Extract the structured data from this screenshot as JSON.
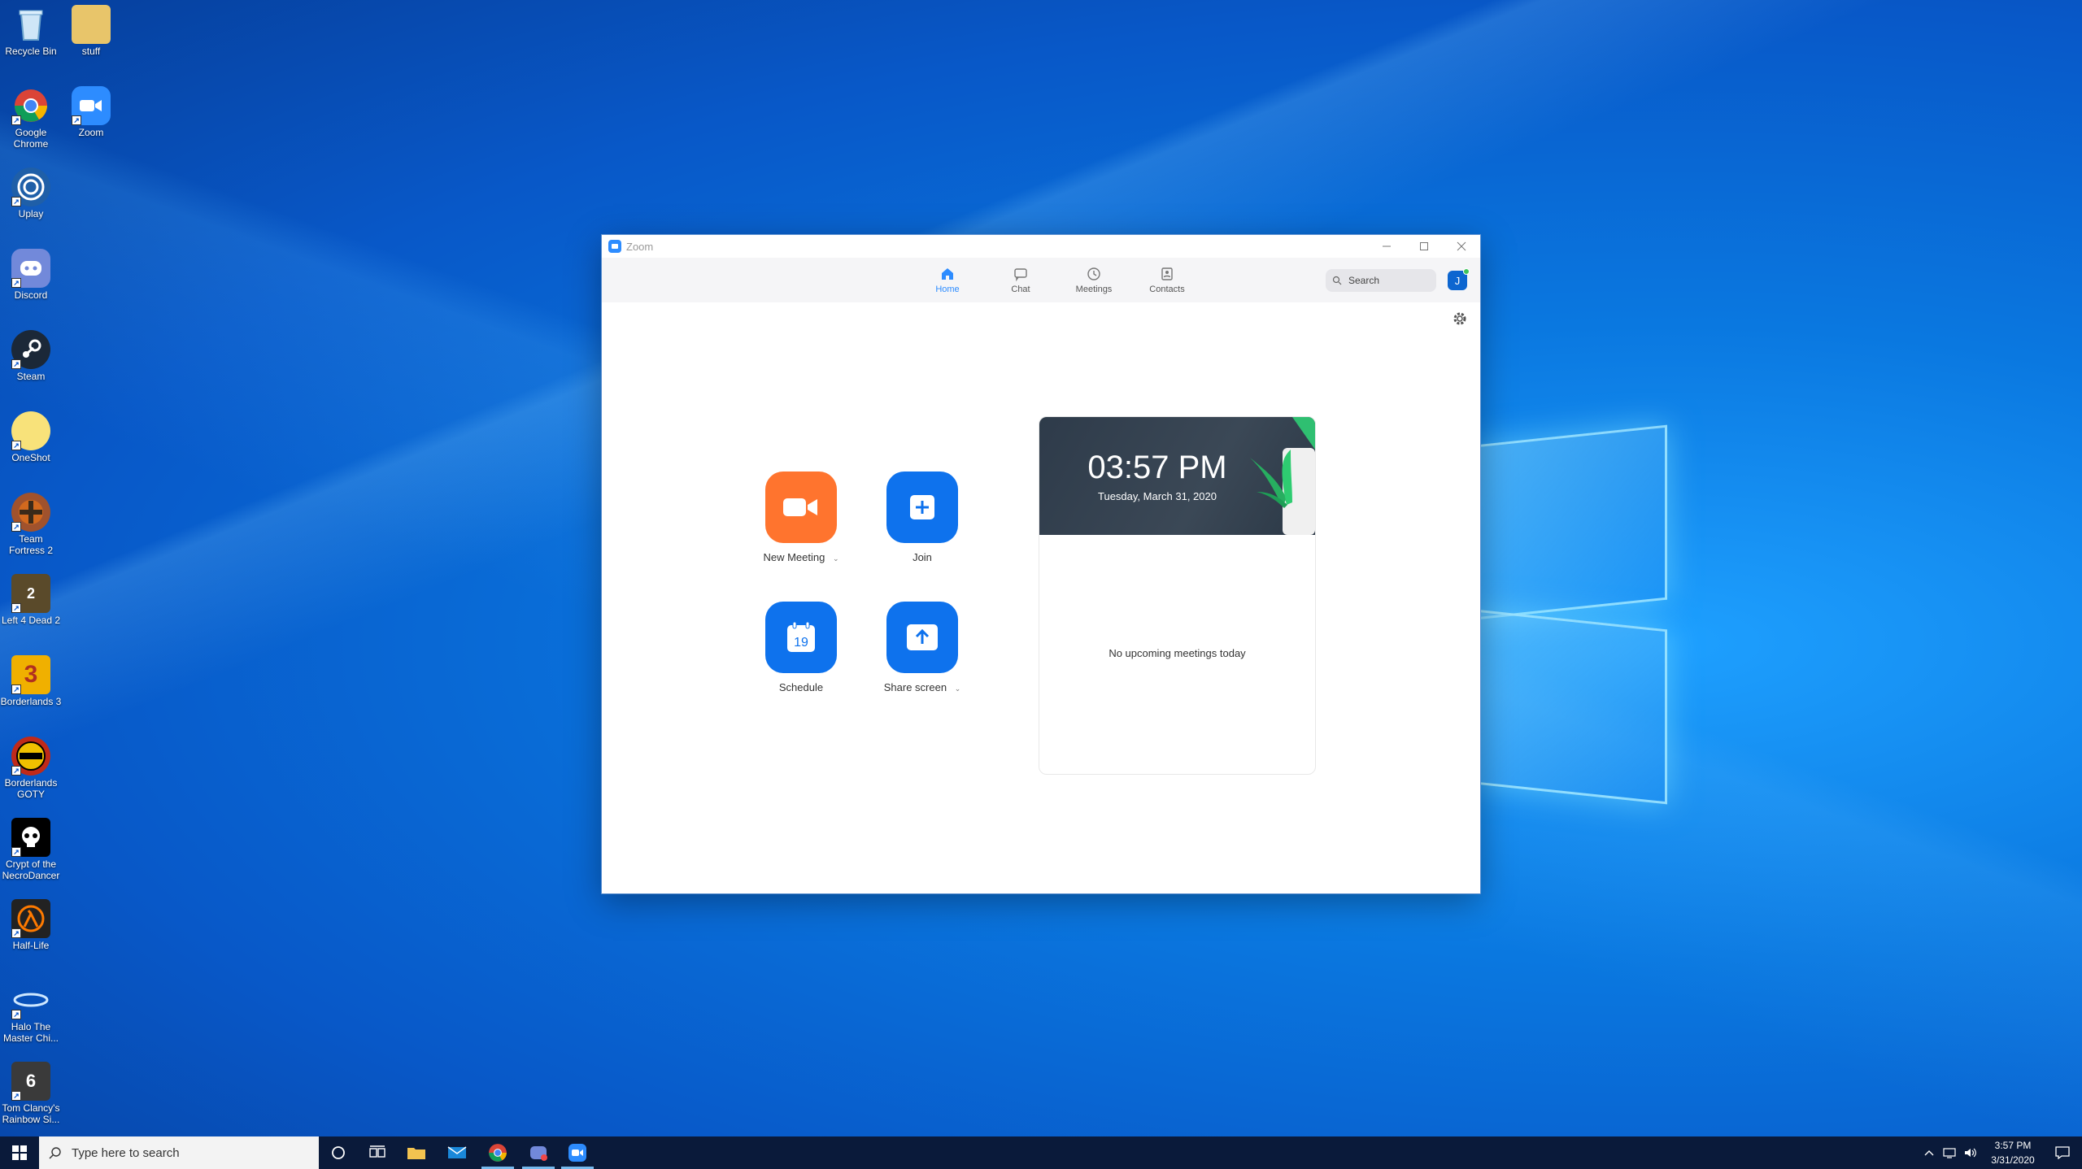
{
  "desktop": {
    "icons": [
      {
        "label": "Recycle Bin"
      },
      {
        "label": "stuff"
      },
      {
        "label": "Google Chrome"
      },
      {
        "label": "Zoom"
      },
      {
        "label": "Uplay"
      },
      {
        "label": "Discord"
      },
      {
        "label": "Steam"
      },
      {
        "label": "OneShot"
      },
      {
        "label": "Team Fortress 2"
      },
      {
        "label": "Left 4 Dead 2"
      },
      {
        "label": "Borderlands 3"
      },
      {
        "label": "Borderlands GOTY"
      },
      {
        "label": "Crypt of the NecroDancer"
      },
      {
        "label": "Half-Life"
      },
      {
        "label": "Halo The Master Chi..."
      },
      {
        "label": "Tom Clancy's Rainbow Si..."
      }
    ]
  },
  "zoom": {
    "window_title": "Zoom",
    "tabs": [
      {
        "label": "Home",
        "icon": "home-icon"
      },
      {
        "label": "Chat",
        "icon": "chat-icon"
      },
      {
        "label": "Meetings",
        "icon": "clock-icon"
      },
      {
        "label": "Contacts",
        "icon": "contacts-icon"
      }
    ],
    "search_placeholder": "Search",
    "avatar_initial": "J",
    "actions": {
      "new_meeting": "New Meeting",
      "join": "Join",
      "schedule": "Schedule",
      "schedule_day": "19",
      "share_screen": "Share screen"
    },
    "card": {
      "time": "03:57 PM",
      "date": "Tuesday, March 31, 2020",
      "no_meetings": "No upcoming meetings today"
    }
  },
  "taskbar": {
    "search_placeholder": "Type here to search",
    "time": "3:57 PM",
    "date": "3/31/2020"
  },
  "colors": {
    "zoom_blue": "#0e72ed",
    "zoom_orange": "#ff742e",
    "desktop_blue": "#0a78e0"
  }
}
